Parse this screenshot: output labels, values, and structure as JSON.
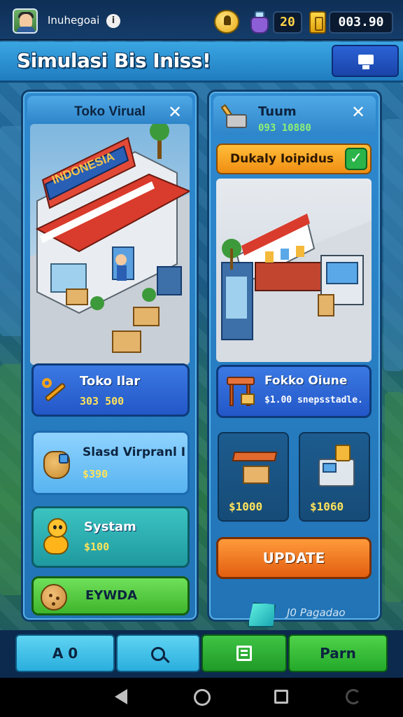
{
  "statusbar": {
    "player_name": "Inuhegoai",
    "info_symbol": "i",
    "gems": "20",
    "money": "003.90"
  },
  "titlebar": {
    "title": "Simulasi Bis Iniss!"
  },
  "left_panel": {
    "title": "Toko Virual",
    "close_symbol": "✕",
    "scene_sign": "INDONESIA",
    "cards": [
      {
        "label": "Toko Ilar",
        "price": "303 500"
      },
      {
        "label": "Slasd Virpranl I",
        "price": "$390"
      },
      {
        "label": "Systam",
        "price": "$100"
      },
      {
        "label": "EYWDA"
      }
    ]
  },
  "right_panel": {
    "title": "Tuum",
    "subtitle": "093 10880",
    "close_symbol": "✕",
    "banner_label": "Dukaly Ioipidus",
    "check_symbol": "✓",
    "feature_card": {
      "label": "Fokko Oiune",
      "price": "$1.00 snepsstadle."
    },
    "tiles": [
      {
        "price": "$1000"
      },
      {
        "price": "$1060"
      }
    ],
    "update_label": "UPDATE"
  },
  "footer": {
    "sub_label": "J0 Pagadao"
  },
  "bottom_nav": {
    "b1": "A 0",
    "b4": "Parn"
  },
  "icons": {
    "avatar": "avatar",
    "info": "info-icon",
    "bulb": "bulb-icon",
    "bag": "bag-icon",
    "coin": "coin-icon",
    "monitor": "monitor-icon",
    "search": "search-icon",
    "document": "document-icon"
  },
  "colors": {
    "primary_blue": "#2f8ad0",
    "accent_orange": "#f08d12",
    "accent_green": "#3fb52b",
    "price_yellow": "#ffe35a"
  }
}
